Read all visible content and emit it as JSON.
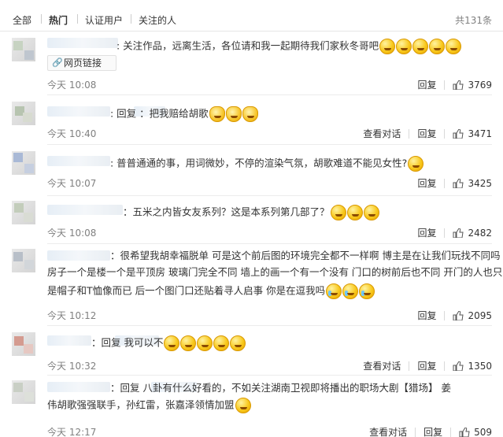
{
  "tabs": {
    "items": [
      "全部",
      "热门",
      "认证用户",
      "关注的人"
    ],
    "active_index": 1,
    "total": "共131条"
  },
  "labels": {
    "reply": "回复",
    "view_conversation": "查看对话",
    "web_link": "网页链接"
  },
  "comments": [
    {
      "text": ": 关注作品，远离生活，各位请和我一起期待我们家秋冬哥吧",
      "emoji": [
        "smile",
        "smile",
        "smile",
        "smile",
        "smile"
      ],
      "has_link": true,
      "time": "今天 10:08",
      "view_conversation": false,
      "likes": "3769"
    },
    {
      "text": ": 回复 ：把我赔给胡歌",
      "emoji": [
        "cat",
        "cat",
        "cat"
      ],
      "time": "今天 10:40",
      "view_conversation": true,
      "likes": "3471"
    },
    {
      "text": ": 普普通通的事，用词微妙，不停的渲染气氛，胡歌难道不能见女性?",
      "emoji": [
        "grin"
      ],
      "time": "今天 10:07",
      "view_conversation": false,
      "likes": "3425"
    },
    {
      "text": "：五米之内皆女友系列？这是本系列第几部了？",
      "emoji": [
        "angry",
        "angry",
        "angry"
      ],
      "time": "今天 10:08",
      "view_conversation": false,
      "likes": "2482"
    },
    {
      "text": "：很希望我胡幸福脱单 可是这个前后图的环境完全都不一样啊 博主是在让我们玩找不同吗",
      "text2": "房子一个是楼一个是平顶房 玻璃门完全不同 墙上的画一个有一个没有 门口的树前后也不同 开门的人也只",
      "text3": "是帽子和T恤像而已 后一个图门口还贴着寻人启事 你是在逗我吗",
      "emoji": [
        "cry",
        "cry",
        "cry"
      ],
      "time": "今天 10:12",
      "view_conversation": false,
      "likes": "2095"
    },
    {
      "text": "：回复 我可以不",
      "emoji": [
        "smile",
        "smile",
        "smile",
        "smile",
        "smile"
      ],
      "time": "今天 10:32",
      "view_conversation": true,
      "likes": "1350"
    },
    {
      "text": "：回复 八卦有什么好看的，不如关注湖南卫视即将播出的职场大剧【猎场】 姜",
      "text2": "伟胡歌强强联手，孙红雷，张嘉泽领情加盟",
      "emoji": [
        "sweat"
      ],
      "time": "今天 12:17",
      "view_conversation": true,
      "likes": "509"
    }
  ]
}
